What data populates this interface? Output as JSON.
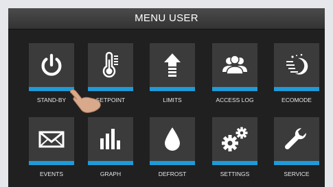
{
  "header": {
    "title": "MENU USER"
  },
  "accent_color": "#1e9bd8",
  "tiles": [
    {
      "label": "STAND-BY",
      "icon": "power-icon"
    },
    {
      "label": "SETPOINT",
      "icon": "thermometer-icon"
    },
    {
      "label": "LIMITS",
      "icon": "arrow-up-icon"
    },
    {
      "label": "ACCESS LOG",
      "icon": "users-icon"
    },
    {
      "label": "ECOMODE",
      "icon": "moon-icon"
    },
    {
      "label": "EVENTS",
      "icon": "envelope-icon"
    },
    {
      "label": "GRAPH",
      "icon": "bar-chart-icon"
    },
    {
      "label": "DEFROST",
      "icon": "drop-icon"
    },
    {
      "label": "SETTINGS",
      "icon": "gears-icon"
    },
    {
      "label": "SERVICE",
      "icon": "wrench-icon"
    }
  ]
}
